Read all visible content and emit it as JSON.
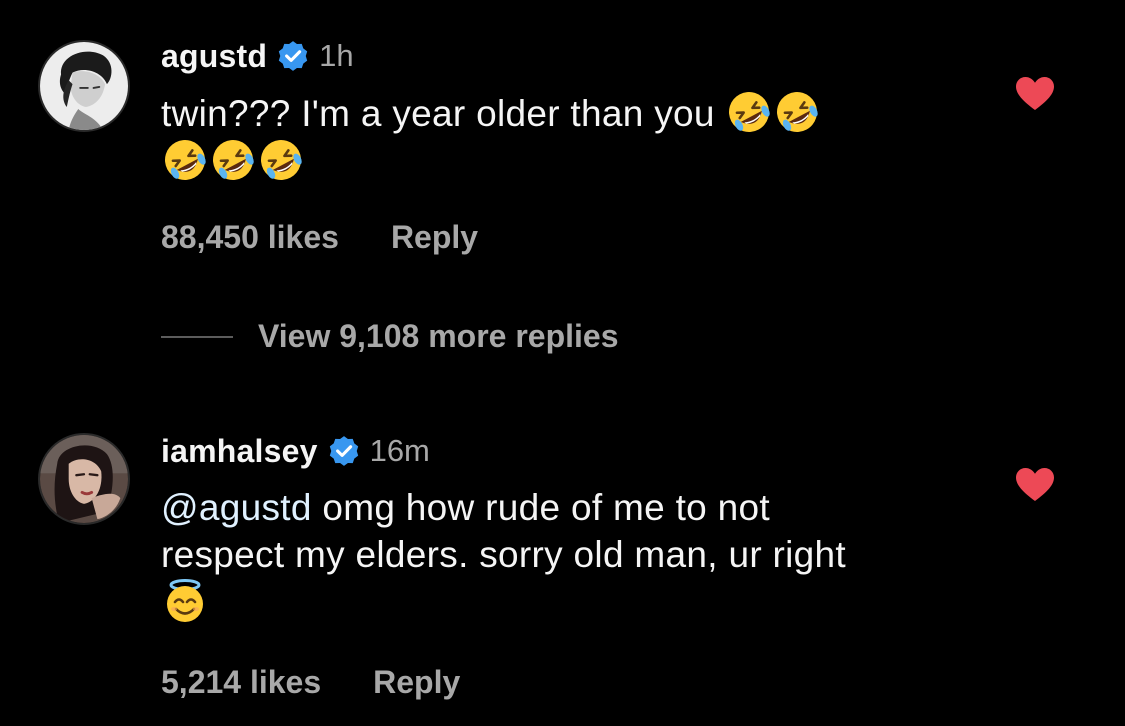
{
  "comments": [
    {
      "username": "agustd",
      "verified": true,
      "time": "1h",
      "text": "twin??? I'm a year older than you",
      "trailing_emoji": [
        "rolling-on-floor-laughing",
        "rolling-on-floor-laughing",
        "rolling-on-floor-laughing",
        "rolling-on-floor-laughing",
        "rolling-on-floor-laughing"
      ],
      "likes": "88,450 likes",
      "reply_label": "Reply",
      "liked": true
    },
    {
      "username": "iamhalsey",
      "verified": true,
      "time": "16m",
      "mention": "@agustd",
      "text": " omg how rude of me to not respect my elders. sorry old man, ur right",
      "trailing_emoji": [
        "smiling-face-with-halo"
      ],
      "likes": "5,214 likes",
      "reply_label": "Reply",
      "liked": true
    }
  ],
  "view_more_replies": "View 9,108 more replies",
  "colors": {
    "background": "#000000",
    "primary_text": "#f5f5f5",
    "secondary_text": "#a8a8a8",
    "verified_badge": "#3897f0",
    "heart": "#ed4956"
  },
  "icons": {
    "verified": "verified-badge-icon",
    "heart": "heart-filled-icon"
  }
}
